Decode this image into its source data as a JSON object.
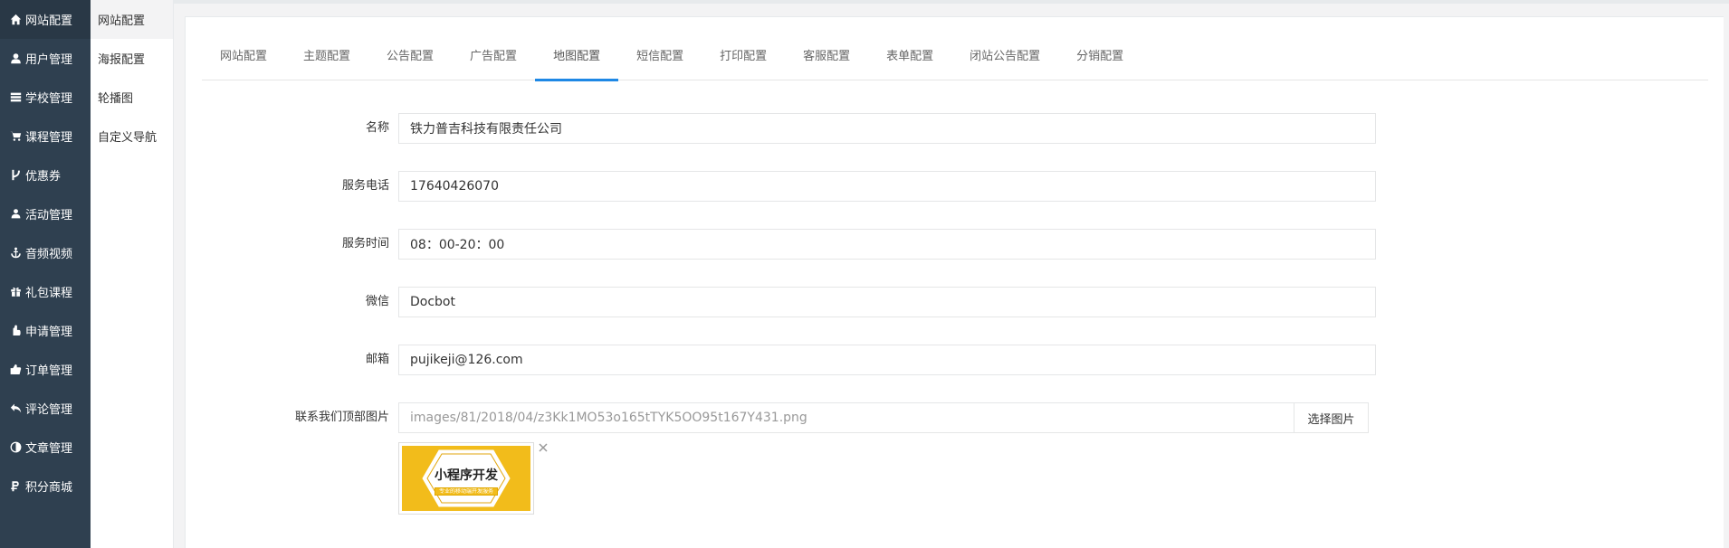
{
  "sidebar": {
    "items": [
      {
        "icon": "home-icon",
        "label": "网站配置"
      },
      {
        "icon": "user-icon",
        "label": "用户管理"
      },
      {
        "icon": "table-icon",
        "label": "学校管理"
      },
      {
        "icon": "cart-icon",
        "label": "课程管理"
      },
      {
        "icon": "branch-icon",
        "label": "优惠券"
      },
      {
        "icon": "users-icon",
        "label": "活动管理"
      },
      {
        "icon": "anchor-icon",
        "label": "音频视频"
      },
      {
        "icon": "gift-icon",
        "label": "礼包课程"
      },
      {
        "icon": "hand-icon",
        "label": "申请管理"
      },
      {
        "icon": "thumbs-icon",
        "label": "订单管理"
      },
      {
        "icon": "reply-icon",
        "label": "评论管理"
      },
      {
        "icon": "contrast-icon",
        "label": "文章管理"
      },
      {
        "icon": "ruble-icon",
        "label": "积分商城"
      }
    ]
  },
  "subnav": {
    "items": [
      {
        "label": "网站配置"
      },
      {
        "label": "海报配置"
      },
      {
        "label": "轮播图"
      },
      {
        "label": "自定义导航"
      }
    ]
  },
  "tabs": [
    {
      "label": "网站配置"
    },
    {
      "label": "主题配置"
    },
    {
      "label": "公告配置"
    },
    {
      "label": "广告配置"
    },
    {
      "label": "地图配置"
    },
    {
      "label": "短信配置"
    },
    {
      "label": "打印配置"
    },
    {
      "label": "客服配置"
    },
    {
      "label": "表单配置"
    },
    {
      "label": "闭站公告配置"
    },
    {
      "label": "分销配置"
    }
  ],
  "active_tab": "地图配置",
  "form": {
    "name": {
      "label": "名称",
      "value": "铁力普吉科技有限责任公司"
    },
    "phone": {
      "label": "服务电话",
      "value": "17640426070"
    },
    "hours": {
      "label": "服务时间",
      "value": "08：00-20：00"
    },
    "wechat": {
      "label": "微信",
      "value": "Docbot"
    },
    "email": {
      "label": "邮箱",
      "value": "pujikeji@126.com"
    },
    "header_image": {
      "label": "联系我们顶部图片",
      "value": "images/81/2018/04/z3Kk1MO53o165tTYK5OO95t167Y431.png",
      "button": "选择图片"
    }
  },
  "thumbnail": {
    "title": "小程序开发",
    "subtitle": "专业的移动端开发服务"
  },
  "colors": {
    "sidebar": "#2f4050",
    "accent": "#1e88e5",
    "thumb": "#f2bc1b"
  }
}
